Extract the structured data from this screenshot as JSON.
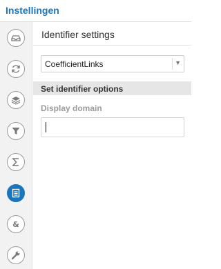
{
  "header": {
    "title": "Instellingen"
  },
  "rail": {
    "items": [
      {
        "icon": "tray-icon",
        "active": false
      },
      {
        "icon": "refresh-icon",
        "active": false
      },
      {
        "icon": "layers-icon",
        "active": false
      },
      {
        "icon": "filter-icon",
        "active": false
      },
      {
        "icon": "sigma-icon",
        "active": false
      },
      {
        "icon": "document-icon",
        "active": true
      },
      {
        "icon": "ampersand-icon",
        "active": false
      },
      {
        "icon": "wrench-icon",
        "active": false
      }
    ],
    "active_color": "#1b75bb"
  },
  "panel": {
    "title": "Identifier settings",
    "identifier_select": {
      "value": "CoefficientLinks"
    },
    "subheader": "Set identifier options",
    "display_domain": {
      "label": "Display domain",
      "value": ""
    }
  }
}
